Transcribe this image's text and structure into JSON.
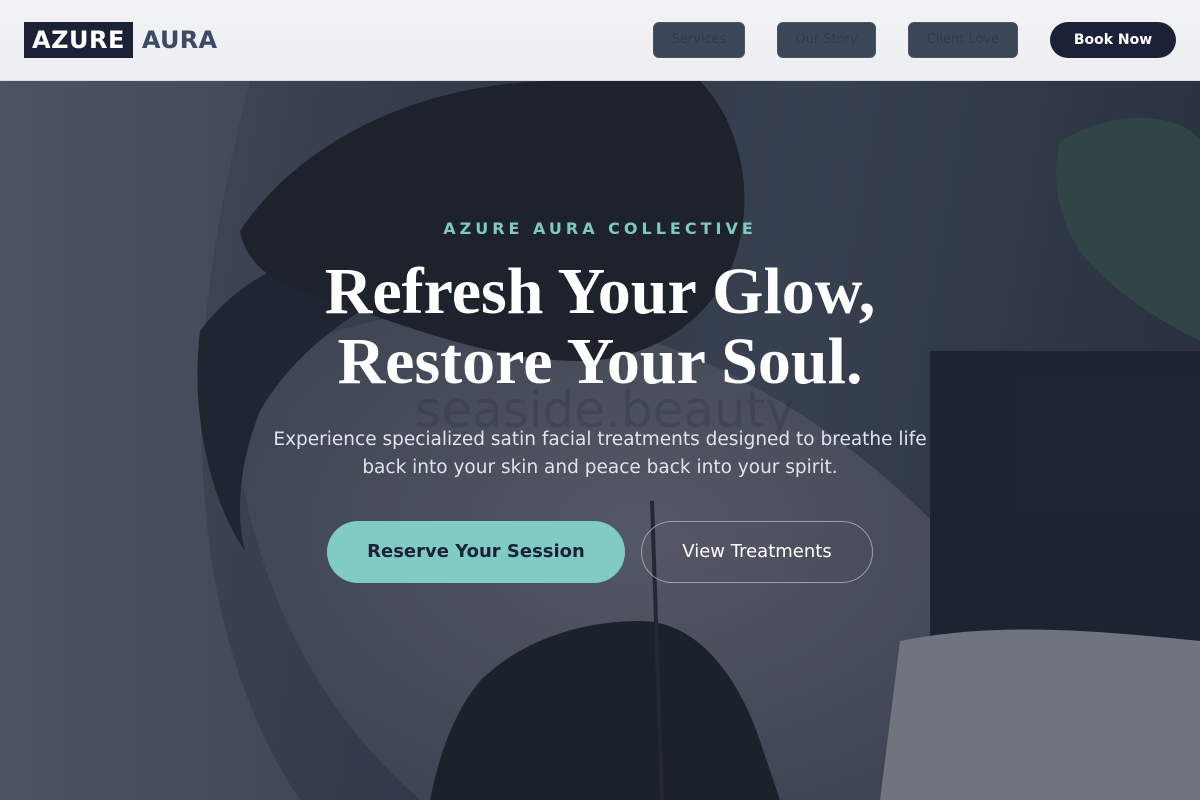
{
  "header": {
    "logo_box": "AZURE",
    "logo_text": "AURA",
    "nav": [
      {
        "label": "Services"
      },
      {
        "label": "Our Story"
      },
      {
        "label": "Client Love"
      }
    ],
    "book_label": "Book Now"
  },
  "hero": {
    "eyebrow": "AZURE AURA COLLECTIVE",
    "headline_line1": "Refresh Your Glow,",
    "headline_line2": "Restore Your Soul.",
    "subtext": "Experience specialized satin facial treatments designed to breathe life back into your skin and peace back into your spirit.",
    "watermark": "seaside.beauty",
    "primary_cta": "Reserve Your Session",
    "secondary_cta": "View Treatments"
  },
  "colors": {
    "navy": "#1b2238",
    "teal_accent": "#80cbc3",
    "header_bg": "#eff1f3"
  }
}
